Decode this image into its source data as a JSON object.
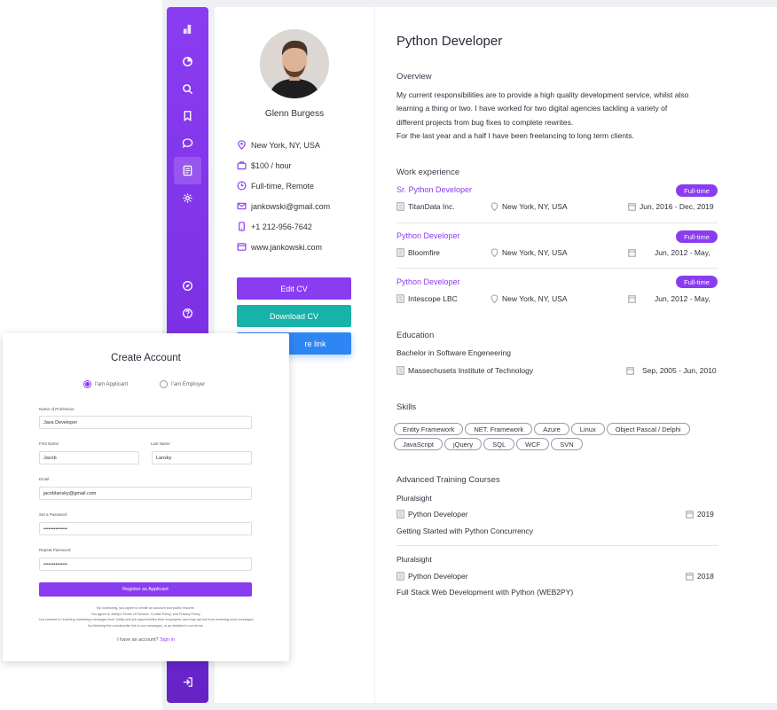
{
  "sidebar": {
    "items": [
      {
        "icon": "app-logo-icon"
      },
      {
        "icon": "pie-chart-icon"
      },
      {
        "icon": "search-icon"
      },
      {
        "icon": "bookmark-icon"
      },
      {
        "icon": "chat-icon"
      },
      {
        "icon": "resume-icon",
        "active": true
      },
      {
        "icon": "gear-icon"
      },
      {
        "icon": "compass-icon"
      },
      {
        "icon": "help-icon"
      },
      {
        "icon": "logout-icon"
      }
    ]
  },
  "profile": {
    "name": "Glenn Burgess",
    "location": "New York, NY, USA",
    "rate": "$100 / hour",
    "availability": "Full-time, Remote",
    "email": "jankowski@gmail.com",
    "phone": "+1 212-956-7642",
    "website": "www.jankowski.com",
    "buttons": {
      "edit": "Edit CV",
      "download": "Download CV",
      "share_partial": "re link"
    }
  },
  "resume": {
    "title": "Python Developer",
    "overview_heading": "Overview",
    "overview_lines": [
      "My current responsibilities are to provide a high quality development service, whilst also",
      "learning a thing or two. I have worked for two digital agencies tackling a variety of",
      "different projects from bug fixes to complete rewrites.",
      "For the last year and a half I have been freelancing to long term clients."
    ],
    "work_heading": "Work experience",
    "jobs": [
      {
        "title": "Sr. Python Developer",
        "badge": "Full-time",
        "company": "TitanData Inc.",
        "location": "New York, NY, USA",
        "dates": "Jun, 2016 - Dec, 2019"
      },
      {
        "title": "Python Developer",
        "badge": "Full-time",
        "company": "Bloomfire",
        "location": "New York, NY, USA",
        "dates": "Jun, 2012 - May,"
      },
      {
        "title": "Python Developer",
        "badge": "Full-time",
        "company": "Intescope LBC",
        "location": "New York, NY, USA",
        "dates": "Jun, 2012 - May,"
      }
    ],
    "education_heading": "Education",
    "education": {
      "degree": "Bachelor in Software Engeneering",
      "school": "Massechusets Institute of Technology",
      "dates": "Sep, 2005 - Jun, 2010"
    },
    "skills_heading": "Skills",
    "skills": [
      "Entity Framework",
      "NET. Framework",
      "Azure",
      "Linux",
      "Object Pascal / Delphi",
      "JavaScript",
      "jQuery",
      "SQL",
      "WCF",
      "SVN"
    ],
    "courses_heading": "Advanced Training Courses",
    "courses": [
      {
        "provider": "Pluralsight",
        "title": "Python Developer",
        "year": "2019",
        "course": "Getting Started with Python Concurrency"
      },
      {
        "provider": "Pluralsight",
        "title": "Python Developer",
        "year": "2018",
        "course": "Full Stack Web Development with Python (WEB2PY)"
      }
    ]
  },
  "signup": {
    "title": "Create Account",
    "radio_applicant": "I'am Applicant",
    "radio_employer": "I'am Employer",
    "profession_label": "Name of Profession",
    "profession_value": "Java Developer",
    "first_name_label": "First Name",
    "first_name_value": "Jacob",
    "last_name_label": "Last Name",
    "last_name_value": "Lansky",
    "email_label": "Email",
    "email_value": "jacoblansky@gmail.com",
    "password_label": "Set a Password",
    "password_value": "••••••••••••••",
    "repeat_label": "Repeat Password",
    "repeat_value": "••••••••••••••",
    "register_button": "Register as Applicant",
    "fine_lines": [
      "By continuing, you agree to create an account and public resume.",
      "You agree to Jobify's Terms Of Service, Cookie Policy, and Privacy Policy.",
      "You consent to receiving marketing messages from Jobify and job opportunities from employers, and may opt out from receiving such messages",
      "by following the unsubscribe link in our messages, or as detailed in our terms."
    ],
    "have_account": "I have an account?",
    "sign_in": "Sign in"
  },
  "colors": {
    "accent": "#8a3cf1",
    "teal": "#17b3a9",
    "blue": "#2e86f5"
  }
}
